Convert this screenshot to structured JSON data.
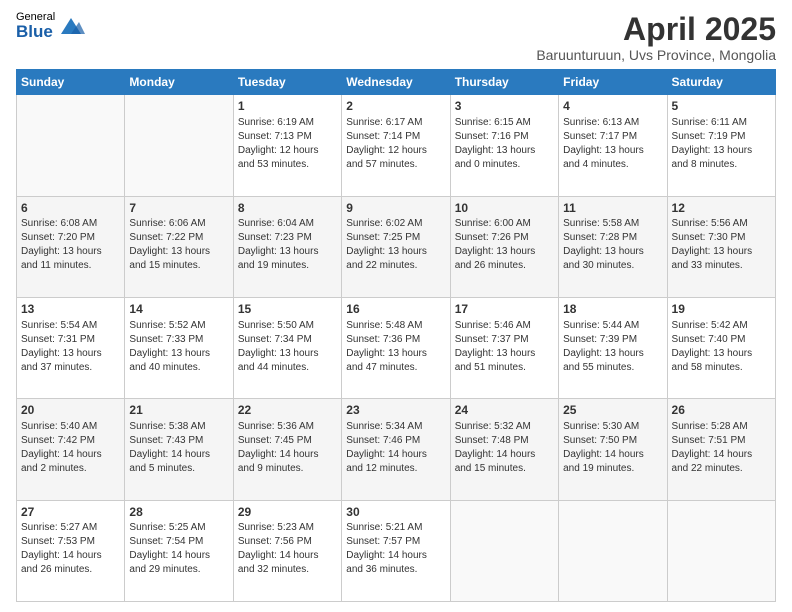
{
  "logo": {
    "general": "General",
    "blue": "Blue"
  },
  "title": "April 2025",
  "subtitle": "Baruunturuun, Uvs Province, Mongolia",
  "weekdays": [
    "Sunday",
    "Monday",
    "Tuesday",
    "Wednesday",
    "Thursday",
    "Friday",
    "Saturday"
  ],
  "weeks": [
    [
      {
        "day": "",
        "sunrise": "",
        "sunset": "",
        "daylight": ""
      },
      {
        "day": "",
        "sunrise": "",
        "sunset": "",
        "daylight": ""
      },
      {
        "day": "1",
        "sunrise": "Sunrise: 6:19 AM",
        "sunset": "Sunset: 7:13 PM",
        "daylight": "Daylight: 12 hours and 53 minutes."
      },
      {
        "day": "2",
        "sunrise": "Sunrise: 6:17 AM",
        "sunset": "Sunset: 7:14 PM",
        "daylight": "Daylight: 12 hours and 57 minutes."
      },
      {
        "day": "3",
        "sunrise": "Sunrise: 6:15 AM",
        "sunset": "Sunset: 7:16 PM",
        "daylight": "Daylight: 13 hours and 0 minutes."
      },
      {
        "day": "4",
        "sunrise": "Sunrise: 6:13 AM",
        "sunset": "Sunset: 7:17 PM",
        "daylight": "Daylight: 13 hours and 4 minutes."
      },
      {
        "day": "5",
        "sunrise": "Sunrise: 6:11 AM",
        "sunset": "Sunset: 7:19 PM",
        "daylight": "Daylight: 13 hours and 8 minutes."
      }
    ],
    [
      {
        "day": "6",
        "sunrise": "Sunrise: 6:08 AM",
        "sunset": "Sunset: 7:20 PM",
        "daylight": "Daylight: 13 hours and 11 minutes."
      },
      {
        "day": "7",
        "sunrise": "Sunrise: 6:06 AM",
        "sunset": "Sunset: 7:22 PM",
        "daylight": "Daylight: 13 hours and 15 minutes."
      },
      {
        "day": "8",
        "sunrise": "Sunrise: 6:04 AM",
        "sunset": "Sunset: 7:23 PM",
        "daylight": "Daylight: 13 hours and 19 minutes."
      },
      {
        "day": "9",
        "sunrise": "Sunrise: 6:02 AM",
        "sunset": "Sunset: 7:25 PM",
        "daylight": "Daylight: 13 hours and 22 minutes."
      },
      {
        "day": "10",
        "sunrise": "Sunrise: 6:00 AM",
        "sunset": "Sunset: 7:26 PM",
        "daylight": "Daylight: 13 hours and 26 minutes."
      },
      {
        "day": "11",
        "sunrise": "Sunrise: 5:58 AM",
        "sunset": "Sunset: 7:28 PM",
        "daylight": "Daylight: 13 hours and 30 minutes."
      },
      {
        "day": "12",
        "sunrise": "Sunrise: 5:56 AM",
        "sunset": "Sunset: 7:30 PM",
        "daylight": "Daylight: 13 hours and 33 minutes."
      }
    ],
    [
      {
        "day": "13",
        "sunrise": "Sunrise: 5:54 AM",
        "sunset": "Sunset: 7:31 PM",
        "daylight": "Daylight: 13 hours and 37 minutes."
      },
      {
        "day": "14",
        "sunrise": "Sunrise: 5:52 AM",
        "sunset": "Sunset: 7:33 PM",
        "daylight": "Daylight: 13 hours and 40 minutes."
      },
      {
        "day": "15",
        "sunrise": "Sunrise: 5:50 AM",
        "sunset": "Sunset: 7:34 PM",
        "daylight": "Daylight: 13 hours and 44 minutes."
      },
      {
        "day": "16",
        "sunrise": "Sunrise: 5:48 AM",
        "sunset": "Sunset: 7:36 PM",
        "daylight": "Daylight: 13 hours and 47 minutes."
      },
      {
        "day": "17",
        "sunrise": "Sunrise: 5:46 AM",
        "sunset": "Sunset: 7:37 PM",
        "daylight": "Daylight: 13 hours and 51 minutes."
      },
      {
        "day": "18",
        "sunrise": "Sunrise: 5:44 AM",
        "sunset": "Sunset: 7:39 PM",
        "daylight": "Daylight: 13 hours and 55 minutes."
      },
      {
        "day": "19",
        "sunrise": "Sunrise: 5:42 AM",
        "sunset": "Sunset: 7:40 PM",
        "daylight": "Daylight: 13 hours and 58 minutes."
      }
    ],
    [
      {
        "day": "20",
        "sunrise": "Sunrise: 5:40 AM",
        "sunset": "Sunset: 7:42 PM",
        "daylight": "Daylight: 14 hours and 2 minutes."
      },
      {
        "day": "21",
        "sunrise": "Sunrise: 5:38 AM",
        "sunset": "Sunset: 7:43 PM",
        "daylight": "Daylight: 14 hours and 5 minutes."
      },
      {
        "day": "22",
        "sunrise": "Sunrise: 5:36 AM",
        "sunset": "Sunset: 7:45 PM",
        "daylight": "Daylight: 14 hours and 9 minutes."
      },
      {
        "day": "23",
        "sunrise": "Sunrise: 5:34 AM",
        "sunset": "Sunset: 7:46 PM",
        "daylight": "Daylight: 14 hours and 12 minutes."
      },
      {
        "day": "24",
        "sunrise": "Sunrise: 5:32 AM",
        "sunset": "Sunset: 7:48 PM",
        "daylight": "Daylight: 14 hours and 15 minutes."
      },
      {
        "day": "25",
        "sunrise": "Sunrise: 5:30 AM",
        "sunset": "Sunset: 7:50 PM",
        "daylight": "Daylight: 14 hours and 19 minutes."
      },
      {
        "day": "26",
        "sunrise": "Sunrise: 5:28 AM",
        "sunset": "Sunset: 7:51 PM",
        "daylight": "Daylight: 14 hours and 22 minutes."
      }
    ],
    [
      {
        "day": "27",
        "sunrise": "Sunrise: 5:27 AM",
        "sunset": "Sunset: 7:53 PM",
        "daylight": "Daylight: 14 hours and 26 minutes."
      },
      {
        "day": "28",
        "sunrise": "Sunrise: 5:25 AM",
        "sunset": "Sunset: 7:54 PM",
        "daylight": "Daylight: 14 hours and 29 minutes."
      },
      {
        "day": "29",
        "sunrise": "Sunrise: 5:23 AM",
        "sunset": "Sunset: 7:56 PM",
        "daylight": "Daylight: 14 hours and 32 minutes."
      },
      {
        "day": "30",
        "sunrise": "Sunrise: 5:21 AM",
        "sunset": "Sunset: 7:57 PM",
        "daylight": "Daylight: 14 hours and 36 minutes."
      },
      {
        "day": "",
        "sunrise": "",
        "sunset": "",
        "daylight": ""
      },
      {
        "day": "",
        "sunrise": "",
        "sunset": "",
        "daylight": ""
      },
      {
        "day": "",
        "sunrise": "",
        "sunset": "",
        "daylight": ""
      }
    ]
  ]
}
